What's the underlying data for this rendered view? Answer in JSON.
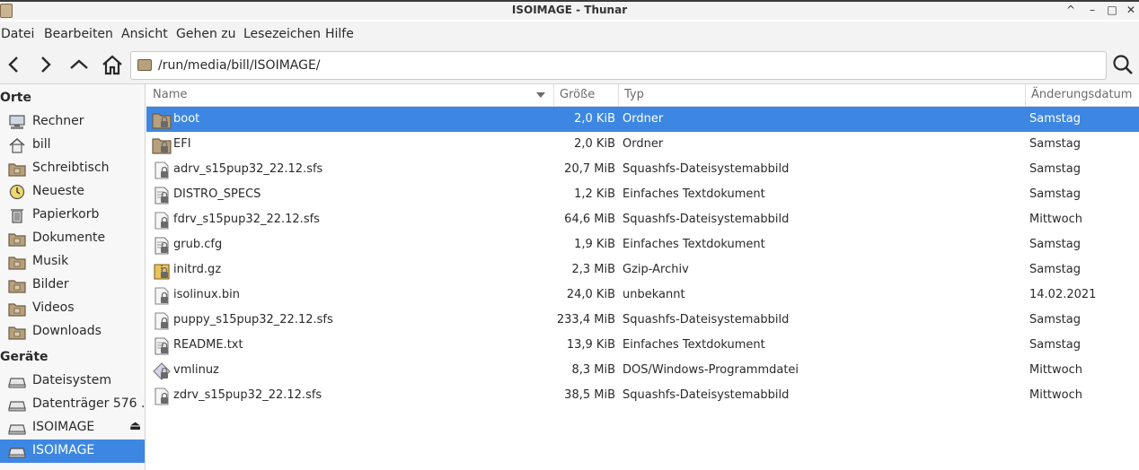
{
  "window": {
    "title": "ISOIMAGE - Thunar"
  },
  "menu": [
    "Datei",
    "Bearbeiten",
    "Ansicht",
    "Gehen zu",
    "Lesezeichen",
    "Hilfe"
  ],
  "toolbar": {
    "path": "/run/media/bill/ISOIMAGE/"
  },
  "sidebar": {
    "places_header": "Orte",
    "places": [
      {
        "label": "Rechner",
        "icon": "computer-icon"
      },
      {
        "label": "bill",
        "icon": "home-icon"
      },
      {
        "label": "Schreibtisch",
        "icon": "desktop-folder-icon"
      },
      {
        "label": "Neueste",
        "icon": "recent-clock-icon"
      },
      {
        "label": "Papierkorb",
        "icon": "trash-icon"
      },
      {
        "label": "Dokumente",
        "icon": "documents-folder-icon"
      },
      {
        "label": "Musik",
        "icon": "music-folder-icon"
      },
      {
        "label": "Bilder",
        "icon": "pictures-folder-icon"
      },
      {
        "label": "Videos",
        "icon": "videos-folder-icon"
      },
      {
        "label": "Downloads",
        "icon": "downloads-folder-icon"
      }
    ],
    "devices_header": "Geräte",
    "devices": [
      {
        "label": "Dateisystem",
        "icon": "drive-icon"
      },
      {
        "label": "Datenträger 576 ...",
        "icon": "drive-icon"
      },
      {
        "label": "ISOIMAGE",
        "icon": "drive-icon",
        "eject": "⏏"
      },
      {
        "label": "ISOIMAGE",
        "icon": "drive-icon",
        "selected": true
      }
    ]
  },
  "columns": {
    "name": "Name",
    "size": "Größe",
    "type": "Typ",
    "date": "Änderungsdatum"
  },
  "files": [
    {
      "name": "boot",
      "size": "2,0 KiB",
      "type": "Ordner",
      "date": "Samstag",
      "kind": "folder",
      "selected": true
    },
    {
      "name": "EFI",
      "size": "2,0 KiB",
      "type": "Ordner",
      "date": "Samstag",
      "kind": "folder"
    },
    {
      "name": "adrv_s15pup32_22.12.sfs",
      "size": "20,7 MiB",
      "type": "Squashfs-Dateisystemabbild",
      "date": "Samstag",
      "kind": "blank"
    },
    {
      "name": "DISTRO_SPECS",
      "size": "1,2 KiB",
      "type": "Einfaches Textdokument",
      "date": "Samstag",
      "kind": "text"
    },
    {
      "name": "fdrv_s15pup32_22.12.sfs",
      "size": "64,6 MiB",
      "type": "Squashfs-Dateisystemabbild",
      "date": "Mittwoch",
      "kind": "blank"
    },
    {
      "name": "grub.cfg",
      "size": "1,9 KiB",
      "type": "Einfaches Textdokument",
      "date": "Samstag",
      "kind": "text"
    },
    {
      "name": "initrd.gz",
      "size": "2,3 MiB",
      "type": "Gzip-Archiv",
      "date": "Samstag",
      "kind": "archive"
    },
    {
      "name": "isolinux.bin",
      "size": "24,0 KiB",
      "type": "unbekannt",
      "date": "14.02.2021",
      "kind": "blank"
    },
    {
      "name": "puppy_s15pup32_22.12.sfs",
      "size": "233,4 MiB",
      "type": "Squashfs-Dateisystemabbild",
      "date": "Samstag",
      "kind": "blank"
    },
    {
      "name": "README.txt",
      "size": "13,9 KiB",
      "type": "Einfaches Textdokument",
      "date": "Samstag",
      "kind": "text"
    },
    {
      "name": "vmlinuz",
      "size": "8,3 MiB",
      "type": "DOS/Windows-Programmdatei",
      "date": "Mittwoch",
      "kind": "exec"
    },
    {
      "name": "zdrv_s15pup32_22.12.sfs",
      "size": "38,5 MiB",
      "type": "Squashfs-Dateisystemabbild",
      "date": "Mittwoch",
      "kind": "blank"
    }
  ],
  "colors": {
    "selection": "#3d87e3",
    "folder": "#b7a07c"
  }
}
